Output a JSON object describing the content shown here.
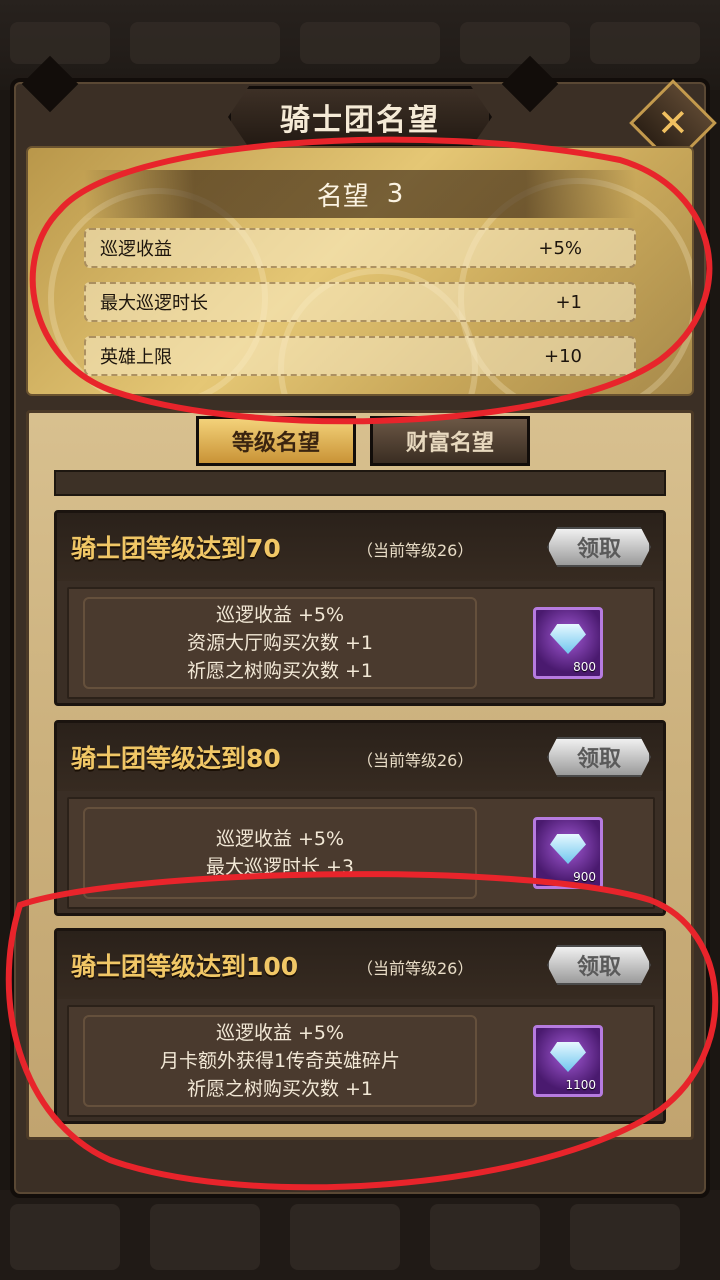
{
  "window": {
    "title": "骑士团名望"
  },
  "close_icon_glyph": "✕",
  "reputation": {
    "header_label": "名望",
    "level": "3",
    "stats": [
      {
        "label": "巡逻收益",
        "value": "+5%"
      },
      {
        "label": "最大巡逻时长",
        "value": "+1"
      },
      {
        "label": "英雄上限",
        "value": "+10"
      }
    ]
  },
  "tabs": [
    {
      "label": "等级名望",
      "active": true
    },
    {
      "label": "财富名望",
      "active": false
    }
  ],
  "rewards": [
    {
      "title": "骑士团等级达到70",
      "current": "（当前等级26）",
      "claim_label": "领取",
      "lines": [
        "巡逻收益 +5%",
        "资源大厅购买次数 +1",
        "祈愿之树购买次数 +1"
      ],
      "gem_count": "800",
      "gem_icon": "diamond-icon"
    },
    {
      "title": "骑士团等级达到80",
      "current": "（当前等级26）",
      "claim_label": "领取",
      "lines": [
        "巡逻收益 +5%",
        "最大巡逻时长 +3"
      ],
      "gem_count": "900",
      "gem_icon": "diamond-icon"
    },
    {
      "title": "骑士团等级达到100",
      "current": "（当前等级26）",
      "claim_label": "领取",
      "lines": [
        "巡逻收益 +5%",
        "月卡额外获得1传奇英雄碎片",
        "祈愿之树购买次数 +1"
      ],
      "gem_count": "1100",
      "gem_icon": "diamond-icon"
    }
  ],
  "colors": {
    "annotation": "#e8242b",
    "title_gold": "#f1c766",
    "gem_purple": "#7a2fb0"
  }
}
